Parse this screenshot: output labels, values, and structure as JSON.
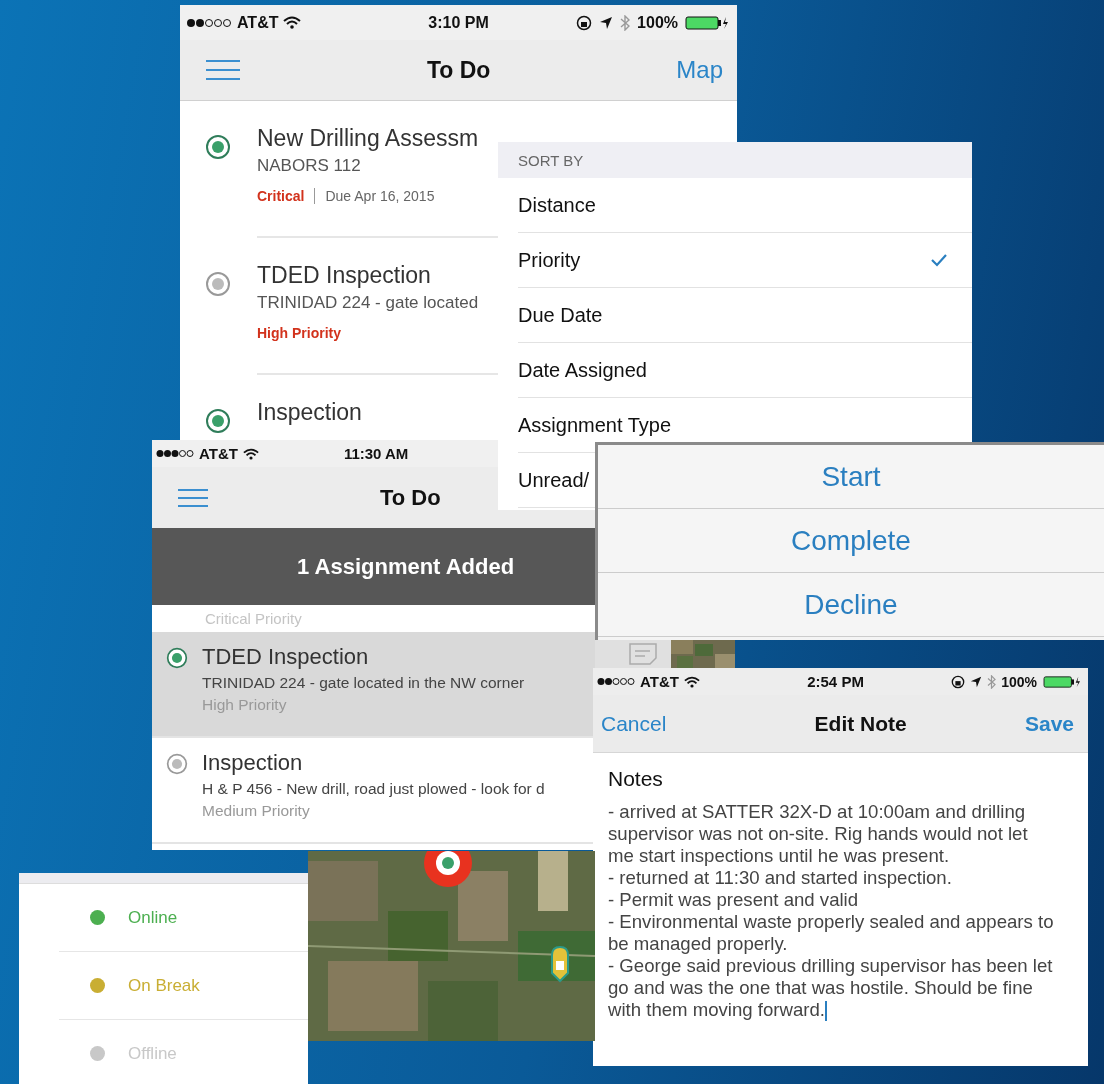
{
  "todo_screen": {
    "status_bar": {
      "carrier": "AT&T",
      "time": "3:10 PM",
      "battery": "100%"
    },
    "title": "To Do",
    "map_button": "Map",
    "assignments": [
      {
        "title": "New Drilling Assessm",
        "location": "NABORS 112",
        "priority": "Critical",
        "due": "Due Apr 16, 2015",
        "active": true
      },
      {
        "title": "TDED Inspection",
        "location": "TRINIDAD 224 - gate located",
        "priority": "High Priority",
        "active": false
      },
      {
        "title": "Inspection",
        "active": true
      }
    ]
  },
  "sort_menu": {
    "header": "SORT BY",
    "options": [
      {
        "label": "Distance",
        "selected": false
      },
      {
        "label": "Priority",
        "selected": true
      },
      {
        "label": "Due Date",
        "selected": false
      },
      {
        "label": "Date Assigned",
        "selected": false
      },
      {
        "label": "Assignment Type",
        "selected": false
      },
      {
        "label": "Unread/",
        "selected": false
      }
    ]
  },
  "todo_screen_2": {
    "status_bar": {
      "carrier": "AT&T",
      "time": "11:30 AM"
    },
    "title": "To Do",
    "banner": "1 Assignment Added",
    "partial_row_priority": "Critical Priority",
    "assignments": [
      {
        "title": "TDED Inspection",
        "location": "TRINIDAD 224 - gate located in the NW corner",
        "priority": "High Priority",
        "active": true,
        "selected": true
      },
      {
        "title": "Inspection",
        "location": "H & P 456 - New drill, road just plowed - look for d",
        "priority": "Medium Priority",
        "active": false,
        "selected": false
      }
    ]
  },
  "action_sheet": [
    "Start",
    "Complete",
    "Decline"
  ],
  "edit_note": {
    "status_bar": {
      "carrier": "AT&T",
      "time": "2:54 PM",
      "battery": "100%"
    },
    "cancel": "Cancel",
    "title": "Edit Note",
    "save": "Save",
    "label": "Notes",
    "text": "- arrived at SATTER 32X-D at 10:00am and drilling supervisor was not on-site. Rig hands would not let me start inspections until he was present.\n- returned at 11:30 and started inspection.\n- Permit was present and valid\n- Environmental waste properly sealed and appears to be managed properly.\n- George said previous drilling supervisor has been let go and was the one that was hostile. Should be fine with them moving forward."
  },
  "presence": [
    {
      "label": "Online",
      "color": "#4caf50"
    },
    {
      "label": "On Break",
      "color": "#c9ae33"
    },
    {
      "label": "Offline",
      "color": "#c8c8c8"
    }
  ]
}
